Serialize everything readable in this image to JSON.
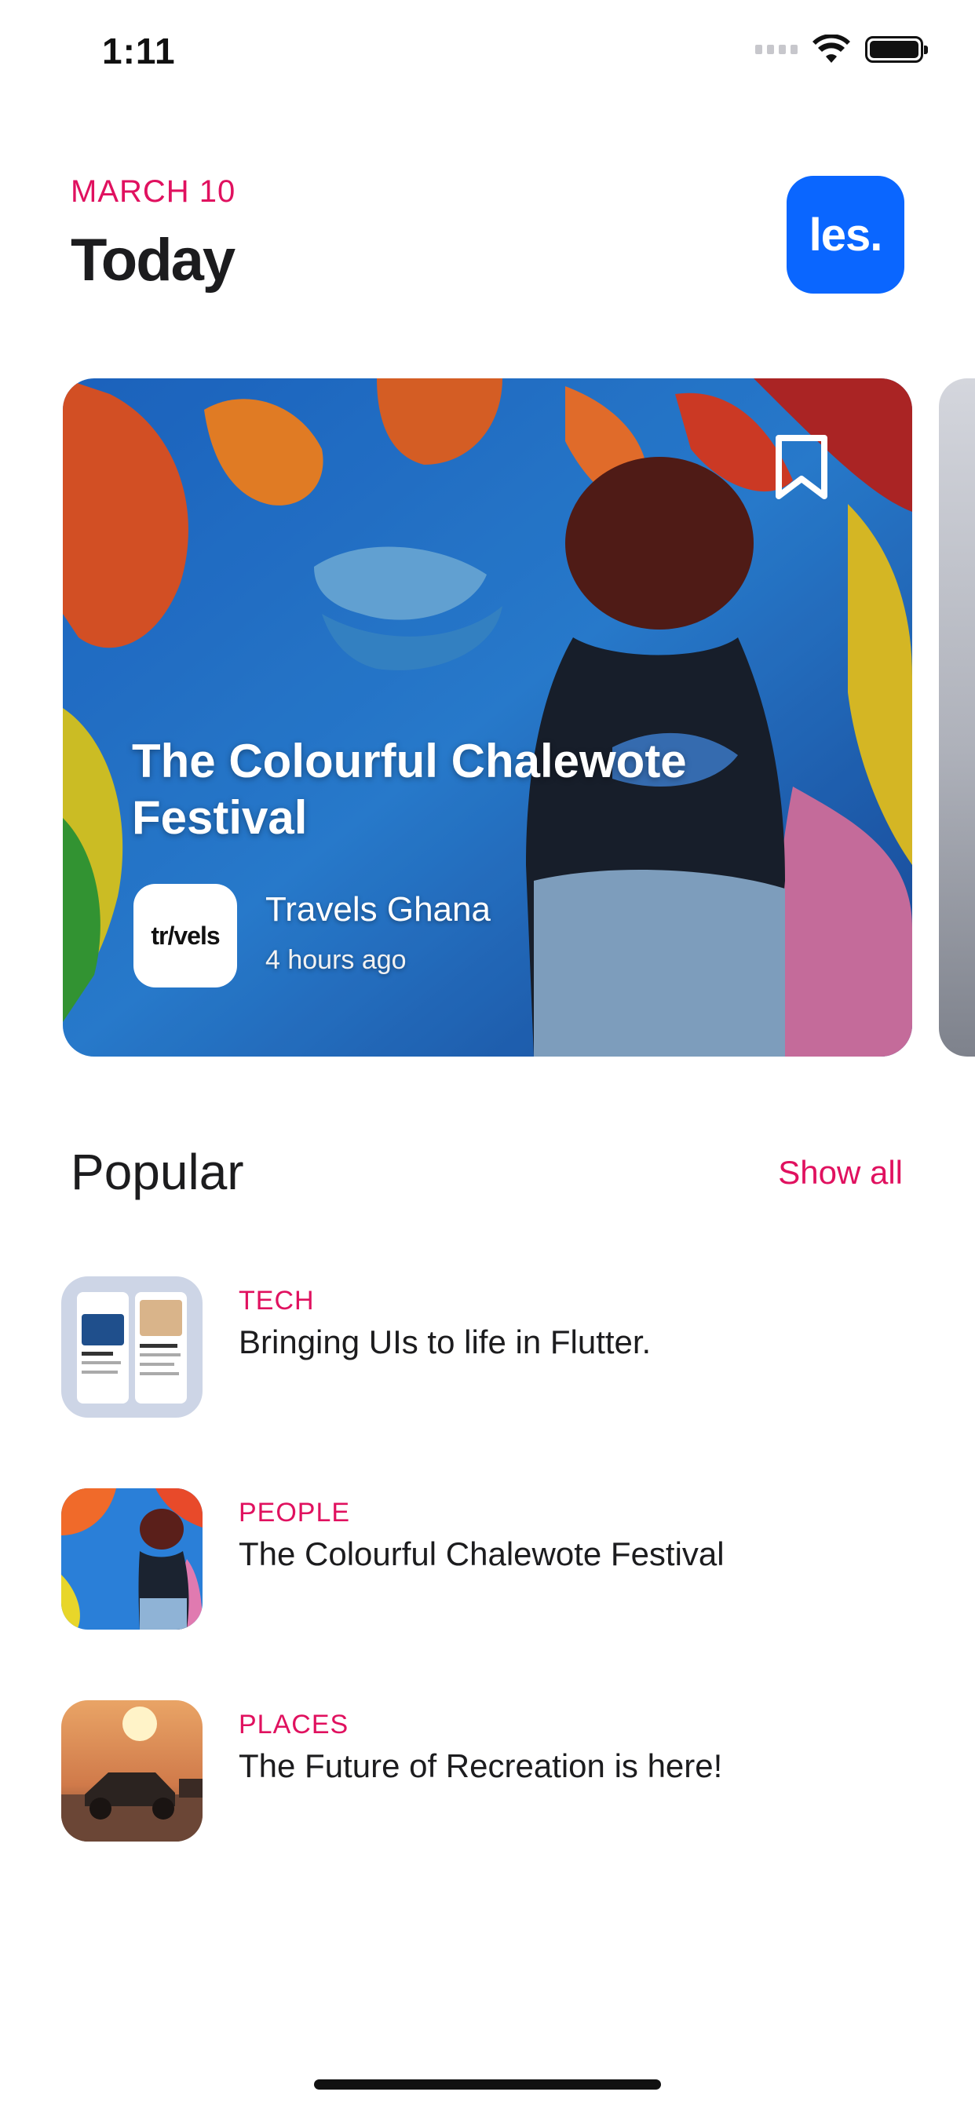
{
  "status_bar": {
    "time": "1:11"
  },
  "header": {
    "date": "MARCH 10",
    "title": "Today",
    "avatar_text": "les."
  },
  "featured": {
    "title": "The Colourful Chalewote Festival",
    "source_logo": "tr/vels",
    "source_name": "Travels Ghana",
    "time_ago": "4 hours ago",
    "bookmark_icon": "bookmark-icon"
  },
  "popular": {
    "title": "Popular",
    "show_all": "Show all",
    "items": [
      {
        "category": "TECH",
        "title": "Bringing UIs to life in Flutter."
      },
      {
        "category": "PEOPLE",
        "title": "The Colourful Chalewote Festival"
      },
      {
        "category": "PLACES",
        "title": "The Future of Recreation is here!"
      }
    ]
  },
  "colors": {
    "accent": "#e0115f",
    "avatar_bg": "#0a66ff",
    "text": "#1c1c1e"
  }
}
